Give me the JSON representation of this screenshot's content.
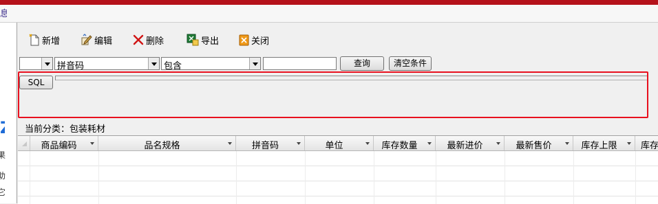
{
  "window": {
    "title_fragment": "息"
  },
  "left_panel": {
    "visible_chars": [
      "果",
      "助",
      "它"
    ]
  },
  "toolbar": {
    "buttons": [
      {
        "label": "新增",
        "icon": "new-document-icon"
      },
      {
        "label": "编辑",
        "icon": "edit-icon"
      },
      {
        "label": "删除",
        "icon": "delete-x-icon"
      },
      {
        "label": "导出",
        "icon": "excel-export-icon"
      },
      {
        "label": "关闭",
        "icon": "close-door-icon"
      }
    ]
  },
  "filter": {
    "logic_value": "",
    "field_value": "拼音码",
    "operator_value": "包含",
    "search_text": "",
    "query_label": "查询",
    "clear_label": "清空条件"
  },
  "sql": {
    "button_label": "SQL"
  },
  "category": {
    "text": "当前分类：包装耗材"
  },
  "grid": {
    "columns": [
      "商品编码",
      "品名规格",
      "拼音码",
      "单位",
      "库存数量",
      "最新进价",
      "最新售价",
      "库存上限",
      "库存"
    ],
    "rows": [
      [],
      [],
      [],
      []
    ]
  },
  "colors": {
    "highlight_border": "#e8101e",
    "title_bar": "#b5121b"
  }
}
